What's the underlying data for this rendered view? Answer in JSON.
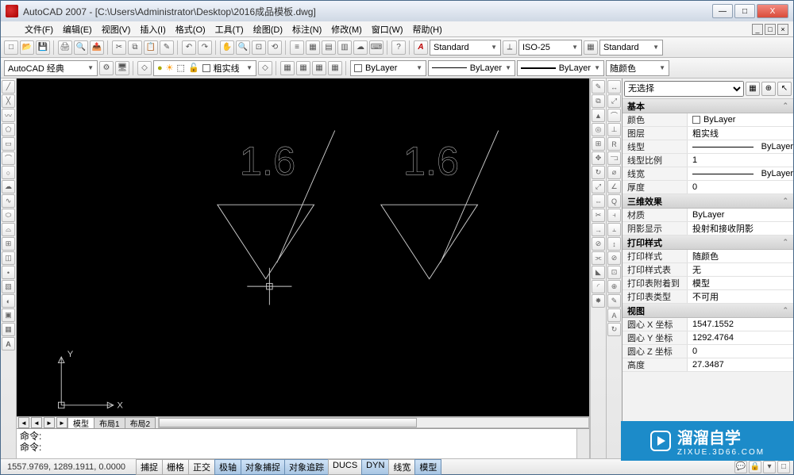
{
  "window": {
    "app_title": "AutoCAD 2007 - [C:\\Users\\Administrator\\Desktop\\2016成品模板.dwg]",
    "min": "—",
    "max": "□",
    "close": "X"
  },
  "menu": {
    "items": [
      "文件(F)",
      "编辑(E)",
      "视图(V)",
      "插入(I)",
      "格式(O)",
      "工具(T)",
      "绘图(D)",
      "标注(N)",
      "修改(M)",
      "窗口(W)",
      "帮助(H)"
    ],
    "mdi_min": "_",
    "mdi_max": "□",
    "mdi_close": "×"
  },
  "toolbar1": {
    "style_label": "Standard",
    "dim_style": "ISO-25",
    "table_style": "Standard"
  },
  "toolbar2": {
    "workspace": "AutoCAD 经典",
    "layer": "粗实线",
    "bylayer1": "ByLayer",
    "bylayer2": "ByLayer",
    "bylayer3": "ByLayer",
    "plot_color": "随颜色"
  },
  "viewport": {
    "text1": "1.6",
    "text2": "1.6",
    "axis_x": "X",
    "axis_y": "Y"
  },
  "layout_tabs": {
    "nav1": "◄",
    "nav2": "◄",
    "nav3": "►",
    "nav4": "►",
    "tabs": [
      "模型",
      "布局1",
      "布局2"
    ],
    "active": 0
  },
  "command": {
    "line1": "命令:",
    "line2": "命令:"
  },
  "status": {
    "coords": "1557.9769, 1289.1911, 0.0000",
    "buttons": [
      "捕捉",
      "栅格",
      "正交",
      "极轴",
      "对象捕捉",
      "对象追踪",
      "DUCS",
      "DYN",
      "线宽",
      "模型"
    ],
    "active": [
      false,
      false,
      false,
      true,
      true,
      true,
      false,
      true,
      false,
      true
    ]
  },
  "palette": {
    "selector": "无选择",
    "groups": [
      {
        "title": "基本",
        "rows": [
          {
            "k": "颜色",
            "v": "ByLayer",
            "swatch": true
          },
          {
            "k": "图层",
            "v": "粗实线"
          },
          {
            "k": "线型",
            "v": "ByLayer",
            "line": true
          },
          {
            "k": "线型比例",
            "v": "1"
          },
          {
            "k": "线宽",
            "v": "ByLayer",
            "line": true
          },
          {
            "k": "厚度",
            "v": "0"
          }
        ]
      },
      {
        "title": "三维效果",
        "rows": [
          {
            "k": "材质",
            "v": "ByLayer"
          },
          {
            "k": "阴影显示",
            "v": "投射和接收阴影"
          }
        ]
      },
      {
        "title": "打印样式",
        "rows": [
          {
            "k": "打印样式",
            "v": "随颜色"
          },
          {
            "k": "打印样式表",
            "v": "无"
          },
          {
            "k": "打印表附着到",
            "v": "模型"
          },
          {
            "k": "打印表类型",
            "v": "不可用"
          }
        ]
      },
      {
        "title": "视图",
        "rows": [
          {
            "k": "圆心 X 坐标",
            "v": "1547.1552"
          },
          {
            "k": "圆心 Y 坐标",
            "v": "1292.4764"
          },
          {
            "k": "圆心 Z 坐标",
            "v": "0"
          },
          {
            "k": "高度",
            "v": "27.3487"
          }
        ]
      }
    ]
  },
  "watermark": {
    "brand": "溜溜自学",
    "url": "ZIXUE.3D66.COM"
  }
}
